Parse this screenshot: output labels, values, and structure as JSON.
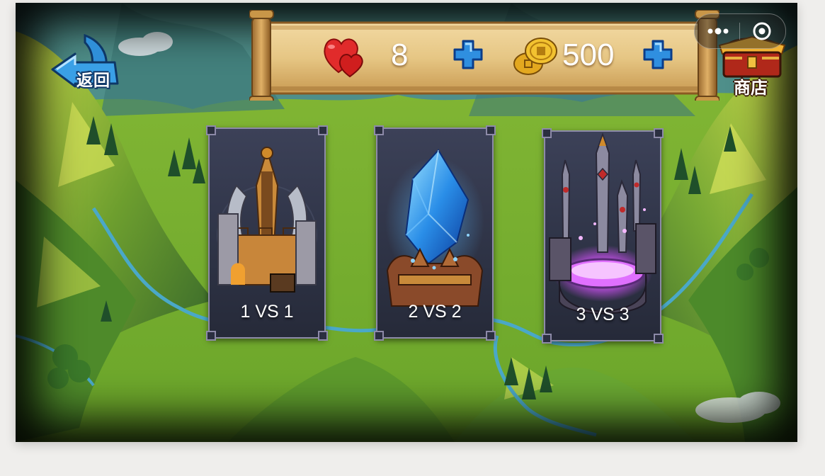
{
  "back": {
    "label": "返回"
  },
  "hud": {
    "lives": "8",
    "coins": "500"
  },
  "shop": {
    "label": "商店"
  },
  "modes": [
    {
      "label": "1 VS 1",
      "icon": "fortress-tower-icon"
    },
    {
      "label": "2 VS 2",
      "icon": "blue-crystal-icon"
    },
    {
      "label": "3 VS 3",
      "icon": "purple-swords-altar-icon"
    }
  ],
  "colors": {
    "grass": "#7fb32c",
    "river": "#4aa8c8",
    "scroll": "#e8c98a",
    "plus": "#2f8fe0",
    "card_border": "#8d8aa8"
  }
}
